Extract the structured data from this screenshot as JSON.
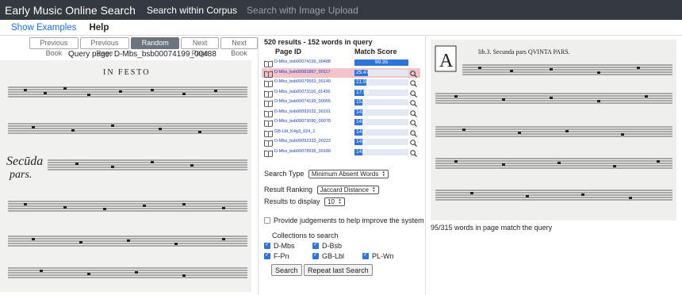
{
  "header": {
    "brand": "Early Music Online Search",
    "nav_corpus": "Search within Corpus",
    "nav_image": "Search with Image Upload"
  },
  "subnav": {
    "examples": "Show Examples",
    "help": "Help"
  },
  "left": {
    "buttons": {
      "prev_book": "Previous Book",
      "prev_page": "Previous Page",
      "random": "Random Page",
      "next_page": "Next Page",
      "next_book": "Next Book"
    },
    "query_label": "Query page: D-Mbs_bsb00074199_00488",
    "score_title": "IN FESTO"
  },
  "results": {
    "summary": "520 results - 152 words in query",
    "col_page": "Page ID",
    "col_score": "Match Score",
    "rows": [
      {
        "id": "D-Mbs_bsb00074199_00488",
        "score": "99.35",
        "fraction": 0.9935
      },
      {
        "id": "D-Mbs_bsb00081867_00117",
        "score": "25.47",
        "fraction": 0.2547
      },
      {
        "id": "D-Mbs_bsb00079563_00149",
        "score": "21.92",
        "fraction": 0.2192
      },
      {
        "id": "D-Mbs_bsb00073116_01436",
        "score": "17.56",
        "fraction": 0.1756
      },
      {
        "id": "D-Mbs_bsb00074199_00055",
        "score": "15.1",
        "fraction": 0.151
      },
      {
        "id": "D-Mbs_bsb00092032_00191",
        "score": "14.6",
        "fraction": 0.146
      },
      {
        "id": "D-Mbs_bsb00073090_00078",
        "score": "14.6",
        "fraction": 0.146
      },
      {
        "id": "GB-Lbl_K4g3_024_1",
        "score": "14.6",
        "fraction": 0.146
      },
      {
        "id": "D-Mbs_bsb00092333_00223",
        "score": "14.6",
        "fraction": 0.146
      },
      {
        "id": "D-Mbs_bsb00078935_00189",
        "score": "14.6",
        "fraction": 0.146
      }
    ]
  },
  "form": {
    "search_type_label": "Search Type",
    "search_type_value": "Minimum Absent Words",
    "ranking_label": "Result Ranking",
    "ranking_value": "Jaccard Distance",
    "display_label": "Results to display",
    "display_value": "10",
    "judgements_label": "Provide judgements to help improve the system",
    "collections_label": "Collections to search",
    "collections": [
      {
        "name": "D-Mbs",
        "checked": true
      },
      {
        "name": "D-Bsb",
        "checked": true
      },
      {
        "name": "F-Pn",
        "checked": true
      },
      {
        "name": "GB-Lbl",
        "checked": true
      },
      {
        "name": "PL-Wn",
        "checked": true
      }
    ],
    "search_button": "Search",
    "repeat_button": "Repeat last Search"
  },
  "right": {
    "match_text": "95/315 words in page match the query"
  }
}
